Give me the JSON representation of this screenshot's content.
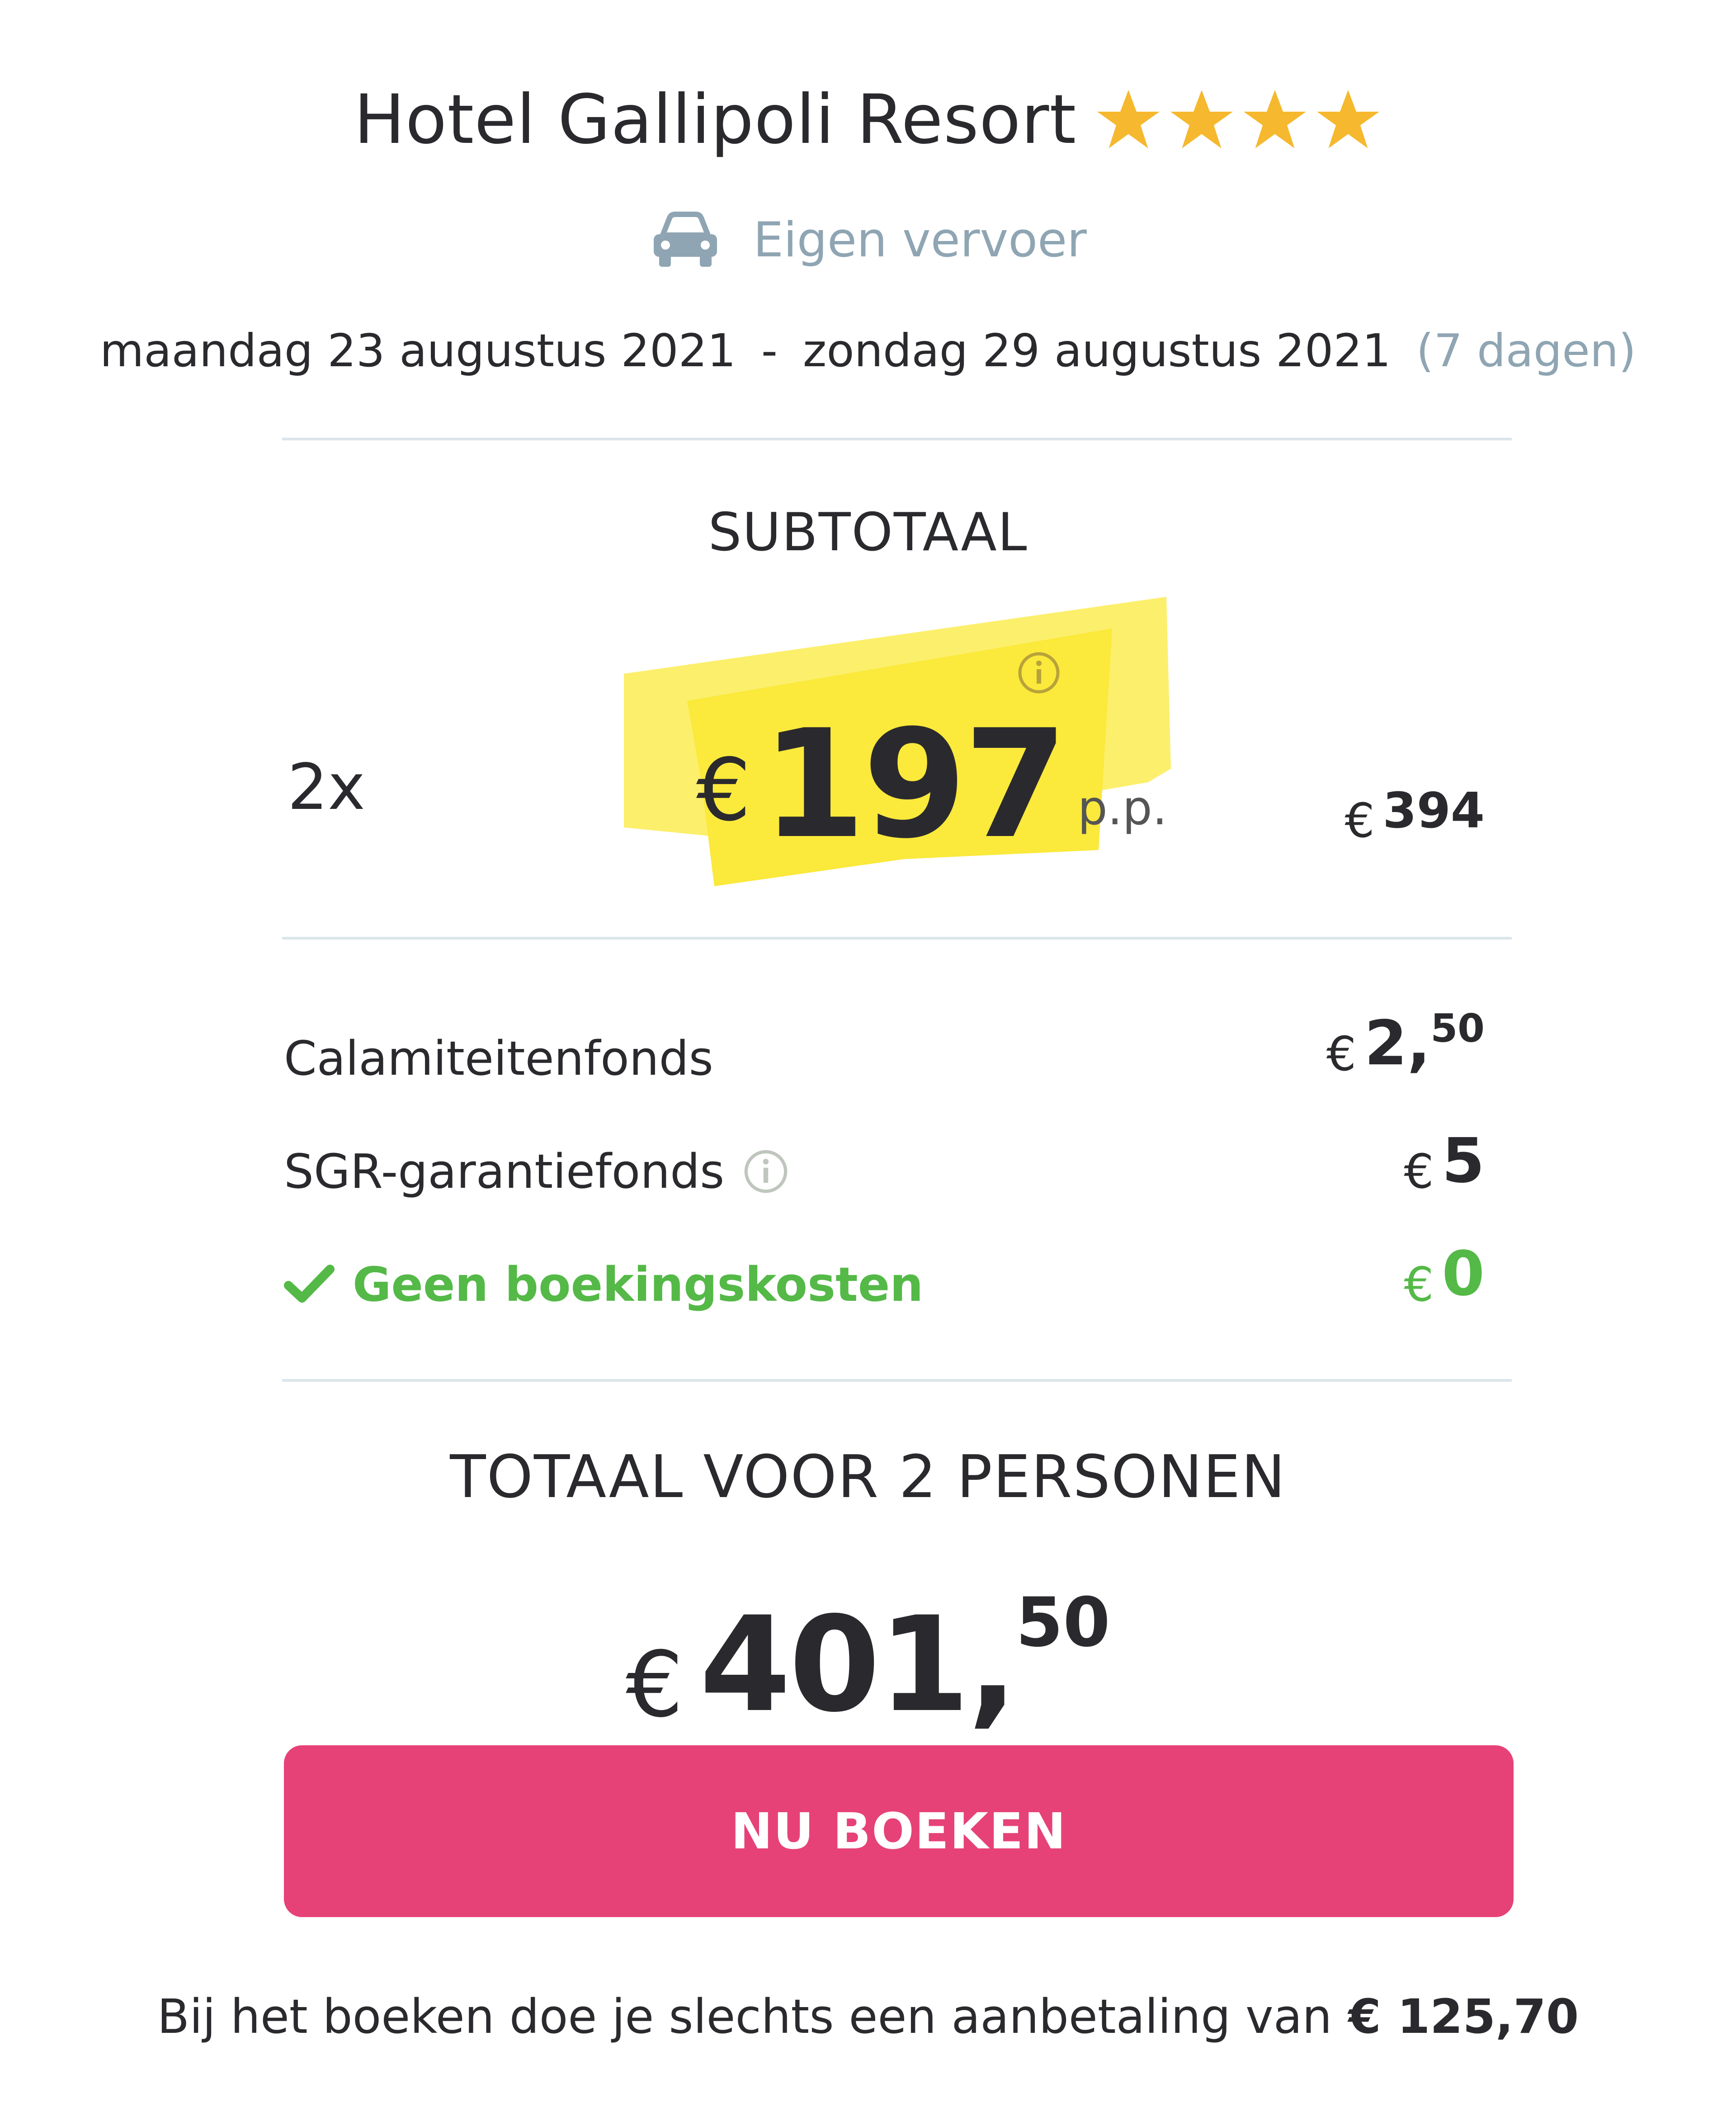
{
  "header": {
    "hotel_name": "Hotel Gallipoli Resort",
    "stars": 4,
    "transport": "Eigen vervoer",
    "date_from": "maandag 23 augustus 2021",
    "date_separator": "-",
    "date_to": "zondag 29 augustus 2021",
    "duration": "(7 dagen)"
  },
  "subtotal": {
    "title": "SUBTOTAAL",
    "count": "2x",
    "currency": "€",
    "price_pp": "197",
    "pp_label": "p.p.",
    "total_currency": "€",
    "total": "394"
  },
  "fees": [
    {
      "label": "Calamiteitenfonds",
      "currency": "€",
      "amount": "2,",
      "cents": "50"
    },
    {
      "label": "SGR-garantiefonds",
      "currency": "€",
      "amount": "5",
      "cents": ""
    },
    {
      "label": "Geen boekingskosten",
      "currency": "€",
      "amount": "0",
      "cents": ""
    }
  ],
  "total": {
    "title": "TOTAAL VOOR 2 PERSONEN",
    "currency": "€",
    "amount": "401,",
    "cents": "50"
  },
  "actions": {
    "book_label": "NU BOEKEN"
  },
  "footer": {
    "deposit_text": "Bij het boeken doe je slechts een aanbetaling van",
    "deposit_amount": "€ 125,70"
  },
  "colors": {
    "star": "#f5b82e",
    "highlight": "#fbe93b",
    "accent_pink": "#e64278",
    "green": "#54b947",
    "muted_blue": "#8fa5b3",
    "divider": "#dbe6ea"
  },
  "icons": {
    "stars": "star-icon",
    "transport": "car-icon",
    "info": "info-icon",
    "no_fee": "check-icon"
  }
}
